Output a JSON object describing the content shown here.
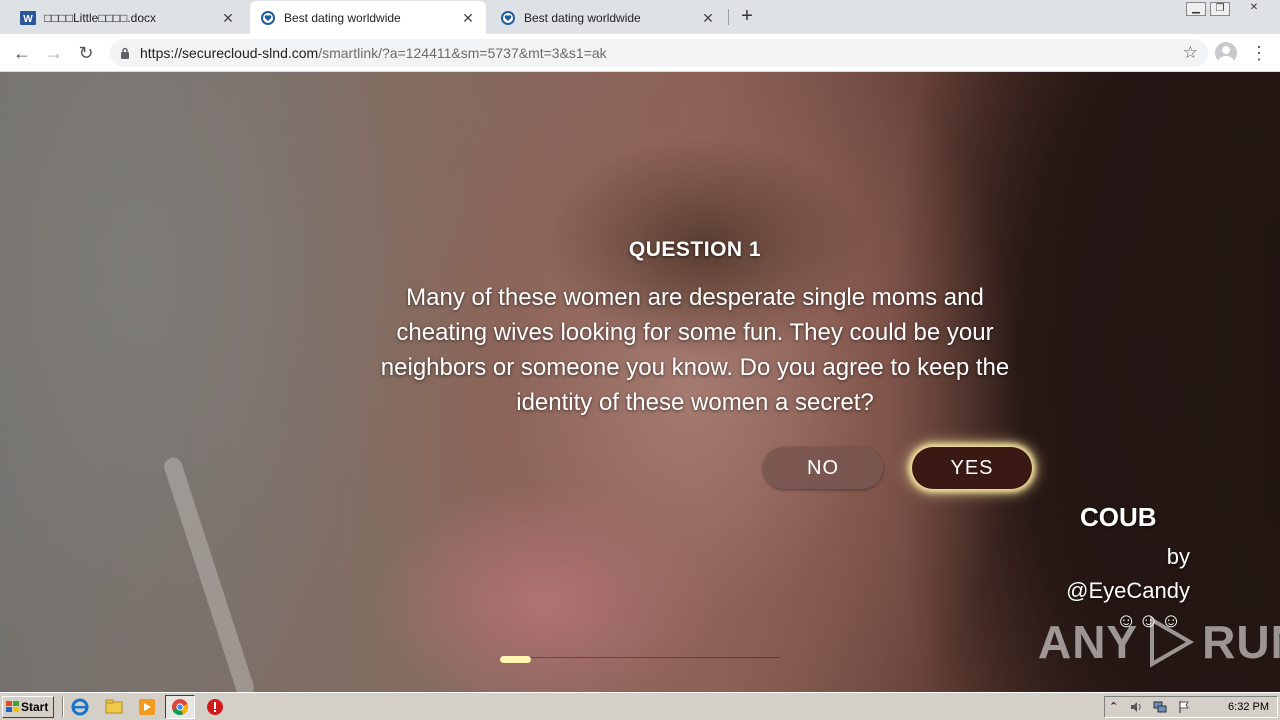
{
  "browser": {
    "tabs": [
      {
        "title": "□□□□Little□□□□.docx",
        "icon": "word-icon",
        "active": false
      },
      {
        "title": "Best dating worldwide",
        "icon": "heart-shield-icon",
        "active": true
      },
      {
        "title": "Best dating worldwide",
        "icon": "heart-shield-icon",
        "active": false
      }
    ],
    "url_host": "https://securecloud-slnd.com",
    "url_path": "/smartlink/?a=124411&sm=5737&mt=3&s1=ak"
  },
  "page": {
    "question_heading": "QUESTION 1",
    "question_text": "Many of these women are desperate single moms and cheating wives looking for some fun. They could be your neighbors or someone you know. Do you agree to keep the identity of these women a secret?",
    "no_label": "NO",
    "yes_label": "YES",
    "coub_brand": "COUB",
    "coub_by": "by",
    "coub_handle": "@EyeCandy",
    "coub_emoji": "☺☺☺",
    "progress_fraction": 0.11,
    "watermark_left": "ANY",
    "watermark_right": "RUN"
  },
  "taskbar": {
    "start_label": "Start",
    "clock": "6:32 PM"
  },
  "colors": {
    "yes_button": "#3a1814",
    "yes_glow": "#f6e6a0",
    "no_button": "#785550",
    "progress_fill": "#fff4b0"
  }
}
